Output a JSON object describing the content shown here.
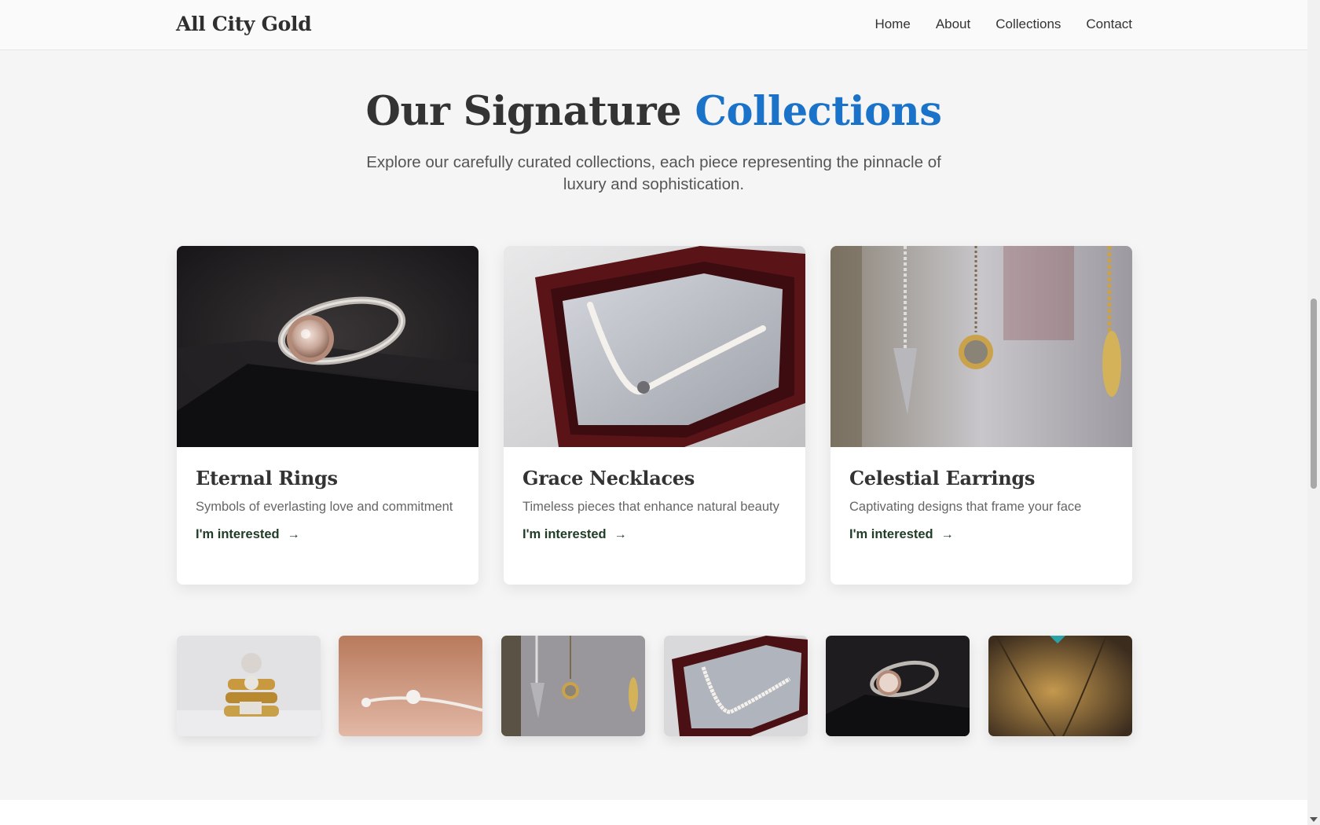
{
  "nav": {
    "brand": "All City Gold",
    "links": [
      "Home",
      "About",
      "Collections",
      "Contact"
    ]
  },
  "section": {
    "title_main": "Our Signature ",
    "title_accent": "Collections",
    "subtitle": "Explore our carefully curated collections, each piece representing the pinnacle of luxury and sophistication."
  },
  "cards": [
    {
      "title": "Eternal Rings",
      "desc": "Symbols of everlasting love and commitment",
      "link": "I'm interested",
      "image": "rose-gold-ring-photo"
    },
    {
      "title": "Grace Necklaces",
      "desc": "Timeless pieces that enhance natural beauty",
      "link": "I'm interested",
      "image": "pearl-necklace-box-photo"
    },
    {
      "title": "Celestial Earrings",
      "desc": "Captivating designs that frame your face",
      "link": "I'm interested",
      "image": "hanging-pendants-photo"
    }
  ],
  "gallery": [
    "stacked-gold-rings-photo",
    "silver-bangle-photo",
    "hanging-pendants-photo",
    "pearl-necklace-box-photo",
    "rose-gold-ring-photo",
    "gold-chain-pendant-photo"
  ],
  "icons": {
    "link_arrow": "arrow-right-icon"
  },
  "colors": {
    "accent": "#1a73c9",
    "link": "#1f3d26",
    "background": "#f5f5f5"
  }
}
